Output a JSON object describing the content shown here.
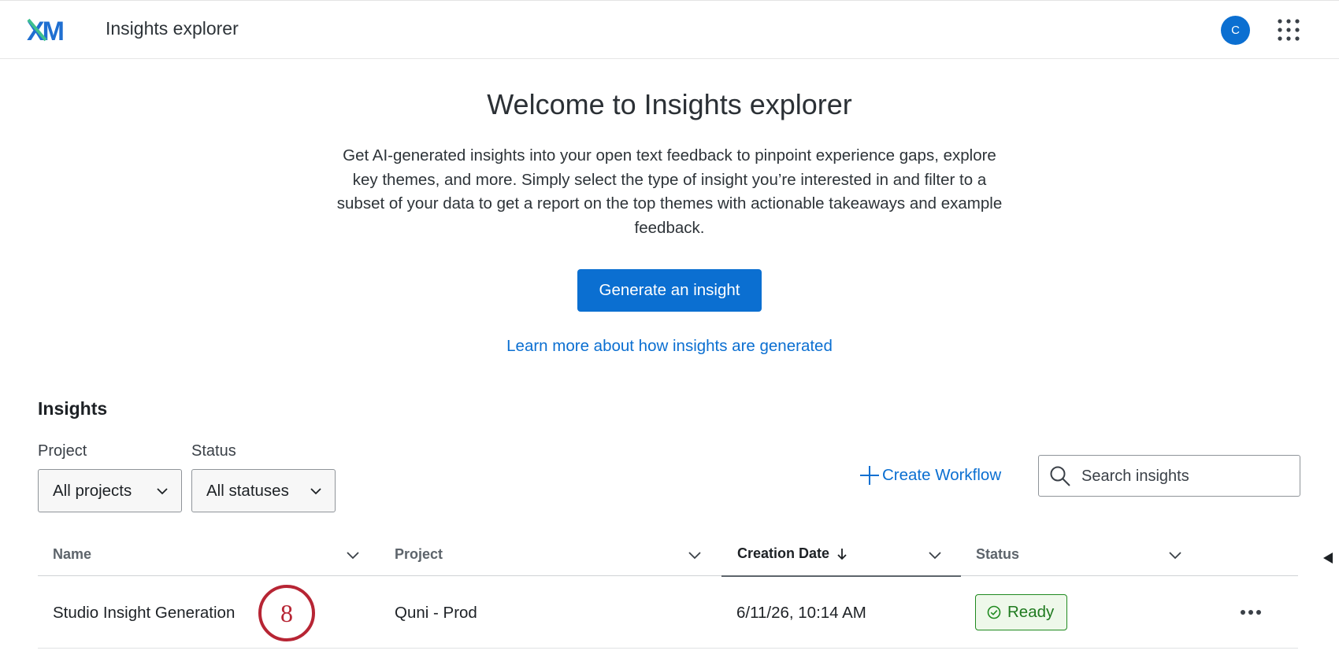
{
  "header": {
    "app_title": "Insights explorer",
    "avatar_initial": "C",
    "logo_text": "XM",
    "brand_colors": {
      "logo_blue": "#1f6fd1",
      "logo_green": "#3ec08f",
      "accent": "#0b6fd1"
    }
  },
  "hero": {
    "title": "Welcome to Insights explorer",
    "description": "Get AI-generated insights into your open text feedback to pinpoint experience gaps, explore key themes, and more. Simply select the type of insight you’re interested in and filter to a subset of your data to get a report on the top themes with actionable takeaways and example feedback.",
    "generate_button": "Generate an insight",
    "learn_more_link": "Learn more about how insights are generated"
  },
  "insights": {
    "section_title": "Insights",
    "filters": {
      "project_label": "Project",
      "project_value": "All projects",
      "status_label": "Status",
      "status_value": "All statuses"
    },
    "create_workflow": "Create Workflow",
    "search_placeholder": "Search insights",
    "columns": {
      "name": "Name",
      "project": "Project",
      "creation_date": "Creation Date",
      "status": "Status"
    },
    "rows": [
      {
        "name": "Studio Insight Generation",
        "project": "Quni - Prod",
        "creation_date": "6/11/26, 10:14 AM",
        "status": "Ready"
      }
    ],
    "status_colors": {
      "ready_text": "#1f7a1f",
      "ready_bg": "#eef8ea"
    }
  },
  "annotation": {
    "step_number": "8"
  }
}
